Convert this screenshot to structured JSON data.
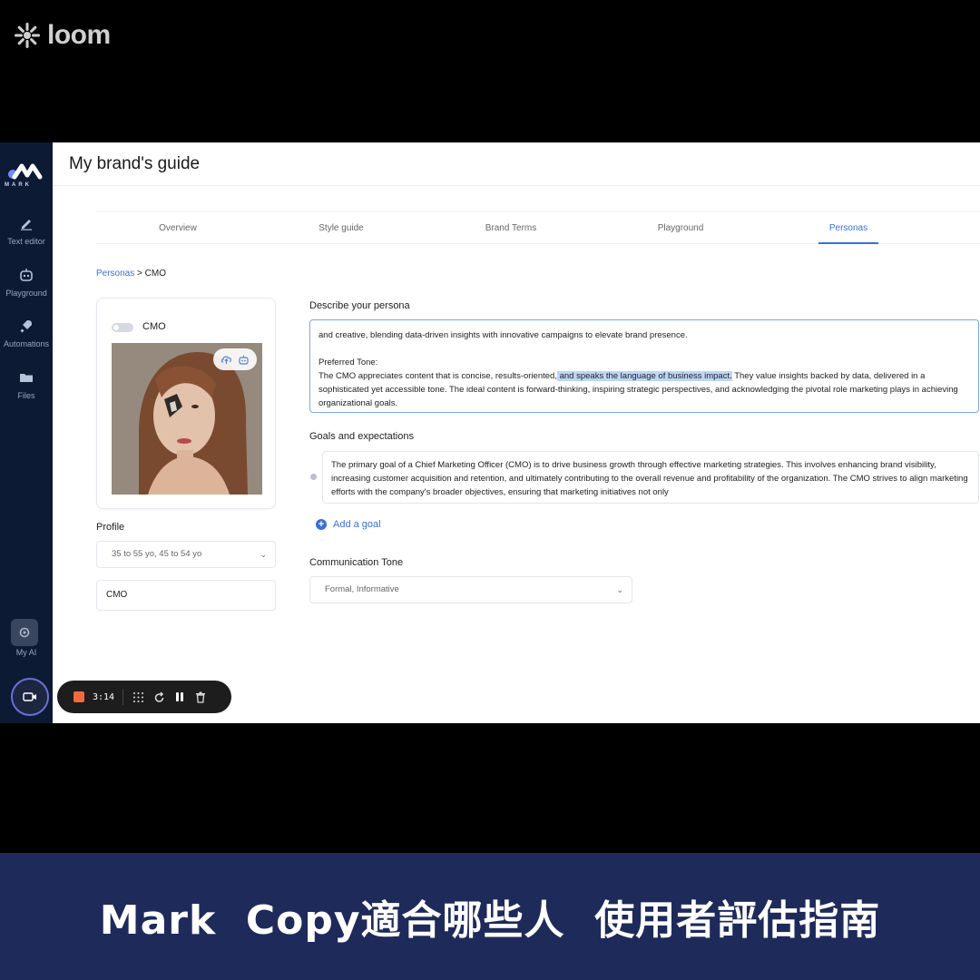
{
  "watermark": {
    "brand": "loom"
  },
  "sidebar": {
    "logo_text": "MARK",
    "items": [
      {
        "label": "Text editor",
        "icon": "pencil-icon"
      },
      {
        "label": "Playground",
        "icon": "robot-icon"
      },
      {
        "label": "Automations",
        "icon": "rocket-icon"
      },
      {
        "label": "Files",
        "icon": "folder-icon"
      }
    ],
    "myai_label": "My AI"
  },
  "header": {
    "title": "My brand's guide"
  },
  "tabs": [
    {
      "label": "Overview",
      "active": false
    },
    {
      "label": "Style guide",
      "active": false
    },
    {
      "label": "Brand Terms",
      "active": false
    },
    {
      "label": "Playground",
      "active": false
    },
    {
      "label": "Personas",
      "active": true
    }
  ],
  "breadcrumb": {
    "parent": "Personas",
    "separator": ">",
    "current": "CMO"
  },
  "persona_card": {
    "name": "CMO",
    "enabled": false
  },
  "profile": {
    "label": "Profile",
    "age_select": "35 to 55 yo, 45 to 54 yo",
    "role_value": "CMO"
  },
  "describe": {
    "label": "Describe your persona",
    "line1": "and creative, blending data-driven insights with innovative campaigns to elevate brand presence.",
    "tone_heading": "Preferred Tone:",
    "tone_before": "The CMO appreciates content that is concise, results-oriented,",
    "tone_highlight": " and speaks the language of business impact.",
    "tone_after": " They value insights backed by data, delivered in a sophisticated yet accessible tone. The ideal content is forward-thinking, inspiring strategic perspectives, and acknowledging the pivotal role marketing plays in achieving organizational goals."
  },
  "goals": {
    "label": "Goals and expectations",
    "items": [
      "The primary goal of a Chief Marketing Officer (CMO) is to drive business growth through effective marketing strategies. This involves enhancing brand visibility, increasing customer acquisition and retention, and ultimately contributing to the overall revenue and profitability of the organization. The CMO strives to align marketing efforts with the company's broader objectives, ensuring that marketing initiatives not only"
    ],
    "add_label": "Add a goal"
  },
  "communication": {
    "label": "Communication Tone",
    "value": "Formal, Informative"
  },
  "recorder": {
    "time": "3:14"
  },
  "banner": {
    "text": "Mark  Copy適合哪些人  使用者評估指南"
  },
  "colors": {
    "accent": "#3b6fd6",
    "sidebar": "#0d1a33",
    "banner": "#1e2a5a",
    "stop": "#f06a3c"
  }
}
